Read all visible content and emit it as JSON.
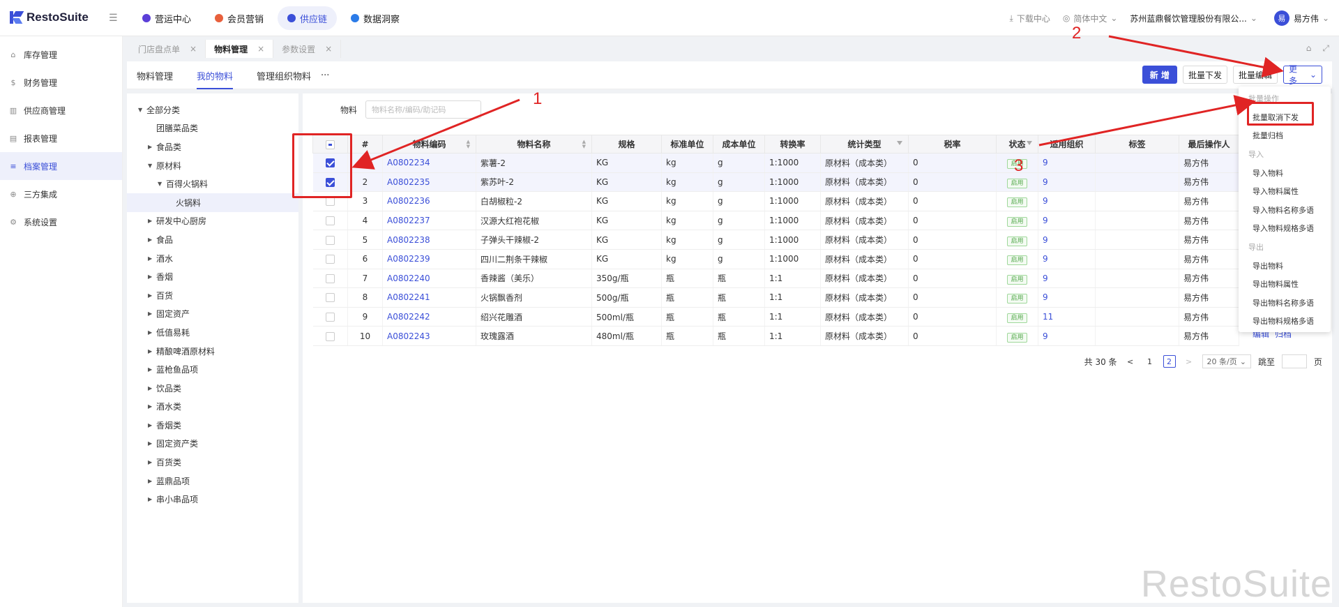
{
  "app": {
    "logo_text": "RestoSuite",
    "brand_color": "#3b4fd8"
  },
  "topnav": [
    {
      "label": "营运中心",
      "color": "#5b3fd8"
    },
    {
      "label": "会员营销",
      "color": "#e8603c"
    },
    {
      "label": "供应链",
      "color": "#3b4fd8",
      "active": true
    },
    {
      "label": "数据洞察",
      "color": "#2b7be8"
    }
  ],
  "topright": {
    "download": "下载中心",
    "language": "简体中文",
    "org": "苏州蓝鼎餐饮管理股份有限公...",
    "avatar_char": "易",
    "user": "易方伟"
  },
  "sidebar": [
    {
      "label": "库存管理",
      "icon": "home-icon"
    },
    {
      "label": "财务管理",
      "icon": "wallet-icon"
    },
    {
      "label": "供应商管理",
      "icon": "building-icon"
    },
    {
      "label": "报表管理",
      "icon": "report-icon"
    },
    {
      "label": "档案管理",
      "icon": "list-icon",
      "active": true
    },
    {
      "label": "三方集成",
      "icon": "link-icon"
    },
    {
      "label": "系统设置",
      "icon": "gear-icon"
    }
  ],
  "page_tabs": [
    {
      "label": "门店盘点单"
    },
    {
      "label": "物料管理",
      "active": true
    },
    {
      "label": "参数设置"
    }
  ],
  "sub_tabs": [
    {
      "label": "物料管理"
    },
    {
      "label": "我的物料",
      "active": true
    },
    {
      "label": "管理组织物料"
    }
  ],
  "sub_tabs_more": "···",
  "actions": {
    "add": "新 增",
    "batch_distribute": "批量下发",
    "batch_edit": "批量编辑",
    "more": "更多"
  },
  "tree": [
    {
      "label": "全部分类",
      "level": 0,
      "open": true
    },
    {
      "label": "团膳菜品类",
      "level": 1,
      "leaf": true
    },
    {
      "label": "食品类",
      "level": 1
    },
    {
      "label": "原材料",
      "level": 1,
      "open": true
    },
    {
      "label": "百得火锅料",
      "level": 2,
      "open": true
    },
    {
      "label": "火锅料",
      "level": 3,
      "leaf": true,
      "selected": true
    },
    {
      "label": "研发中心厨房",
      "level": 1
    },
    {
      "label": "食品",
      "level": 1
    },
    {
      "label": "酒水",
      "level": 1
    },
    {
      "label": "香烟",
      "level": 1
    },
    {
      "label": "百货",
      "level": 1
    },
    {
      "label": "固定资产",
      "level": 1
    },
    {
      "label": "低值易耗",
      "level": 1
    },
    {
      "label": "精酿啤酒原材料",
      "level": 1
    },
    {
      "label": "蓝枪鱼品项",
      "level": 1
    },
    {
      "label": "饮品类",
      "level": 1
    },
    {
      "label": "酒水类",
      "level": 1
    },
    {
      "label": "香烟类",
      "level": 1
    },
    {
      "label": "固定资产类",
      "level": 1
    },
    {
      "label": "百货类",
      "level": 1
    },
    {
      "label": "蓝鼎品项",
      "level": 1
    },
    {
      "label": "串小串品项",
      "level": 1
    }
  ],
  "filter": {
    "label": "物料",
    "placeholder": "物料名称/编码/助记码"
  },
  "table": {
    "headers": [
      "#",
      "物料编码",
      "物料名称",
      "规格",
      "标准单位",
      "成本单位",
      "转换率",
      "统计类型",
      "税率",
      "状态",
      "适用组织",
      "标签",
      "最后操作人"
    ],
    "rows": [
      {
        "checked": true,
        "no": "1",
        "code": "A0802234",
        "name": "紫薯-2",
        "spec": "KG",
        "std": "kg",
        "cost": "g",
        "rate": "1:1000",
        "type": "原材料（成本类）",
        "tax": "0",
        "status": "启用",
        "org": "9",
        "tag": "",
        "op": "易方伟"
      },
      {
        "checked": true,
        "no": "2",
        "code": "A0802235",
        "name": "紫苏叶-2",
        "spec": "KG",
        "std": "kg",
        "cost": "g",
        "rate": "1:1000",
        "type": "原材料（成本类）",
        "tax": "0",
        "status": "启用",
        "org": "9",
        "tag": "",
        "op": "易方伟"
      },
      {
        "checked": false,
        "no": "3",
        "code": "A0802236",
        "name": "白胡椒粒-2",
        "spec": "KG",
        "std": "kg",
        "cost": "g",
        "rate": "1:1000",
        "type": "原材料（成本类）",
        "tax": "0",
        "status": "启用",
        "org": "9",
        "tag": "",
        "op": "易方伟"
      },
      {
        "checked": false,
        "no": "4",
        "code": "A0802237",
        "name": "汉源大红袍花椒",
        "spec": "KG",
        "std": "kg",
        "cost": "g",
        "rate": "1:1000",
        "type": "原材料（成本类）",
        "tax": "0",
        "status": "启用",
        "org": "9",
        "tag": "",
        "op": "易方伟"
      },
      {
        "checked": false,
        "no": "5",
        "code": "A0802238",
        "name": "子弹头干辣椒-2",
        "spec": "KG",
        "std": "kg",
        "cost": "g",
        "rate": "1:1000",
        "type": "原材料（成本类）",
        "tax": "0",
        "status": "启用",
        "org": "9",
        "tag": "",
        "op": "易方伟"
      },
      {
        "checked": false,
        "no": "6",
        "code": "A0802239",
        "name": "四川二荆条干辣椒",
        "spec": "KG",
        "std": "kg",
        "cost": "g",
        "rate": "1:1000",
        "type": "原材料（成本类）",
        "tax": "0",
        "status": "启用",
        "org": "9",
        "tag": "",
        "op": "易方伟"
      },
      {
        "checked": false,
        "no": "7",
        "code": "A0802240",
        "name": "香辣酱（美乐）",
        "spec": "350g/瓶",
        "std": "瓶",
        "cost": "瓶",
        "rate": "1:1",
        "type": "原材料（成本类）",
        "tax": "0",
        "status": "启用",
        "org": "9",
        "tag": "",
        "op": "易方伟"
      },
      {
        "checked": false,
        "no": "8",
        "code": "A0802241",
        "name": "火锅飘香剂",
        "spec": "500g/瓶",
        "std": "瓶",
        "cost": "瓶",
        "rate": "1:1",
        "type": "原材料（成本类）",
        "tax": "0",
        "status": "启用",
        "org": "9",
        "tag": "",
        "op": "易方伟"
      },
      {
        "checked": false,
        "no": "9",
        "code": "A0802242",
        "name": "绍兴花雕酒",
        "spec": "500ml/瓶",
        "std": "瓶",
        "cost": "瓶",
        "rate": "1:1",
        "type": "原材料（成本类）",
        "tax": "0",
        "status": "启用",
        "org": "11",
        "tag": "",
        "op": "易方伟"
      },
      {
        "checked": false,
        "no": "10",
        "code": "A0802243",
        "name": "玫瑰露酒",
        "spec": "480ml/瓶",
        "std": "瓶",
        "cost": "瓶",
        "rate": "1:1",
        "type": "原材料（成本类）",
        "tax": "0",
        "status": "启用",
        "org": "9",
        "tag": "",
        "op": "易方伟"
      }
    ]
  },
  "row_ops": {
    "edit": "编辑",
    "archive": "归档"
  },
  "pager": {
    "total": "共 30 条",
    "prev": "<",
    "page1": "1",
    "page2": "2",
    "next": ">",
    "size": "20 条/页",
    "jump": "跳至",
    "page_unit": "页"
  },
  "dropdown": [
    {
      "label": "批量操作",
      "group": true
    },
    {
      "label": "批量取消下发"
    },
    {
      "label": "批量归档"
    },
    {
      "label": "导入",
      "group": true
    },
    {
      "label": "导入物料"
    },
    {
      "label": "导入物料属性"
    },
    {
      "label": "导入物料名称多语"
    },
    {
      "label": "导入物料规格多语"
    },
    {
      "label": "导出",
      "group": true
    },
    {
      "label": "导出物料"
    },
    {
      "label": "导出物料属性"
    },
    {
      "label": "导出物料名称多语"
    },
    {
      "label": "导出物料规格多语"
    }
  ],
  "annotations": {
    "n1": "1",
    "n2": "2",
    "n3": "3",
    "color": "#e02424"
  },
  "watermark": "RestoSuite"
}
